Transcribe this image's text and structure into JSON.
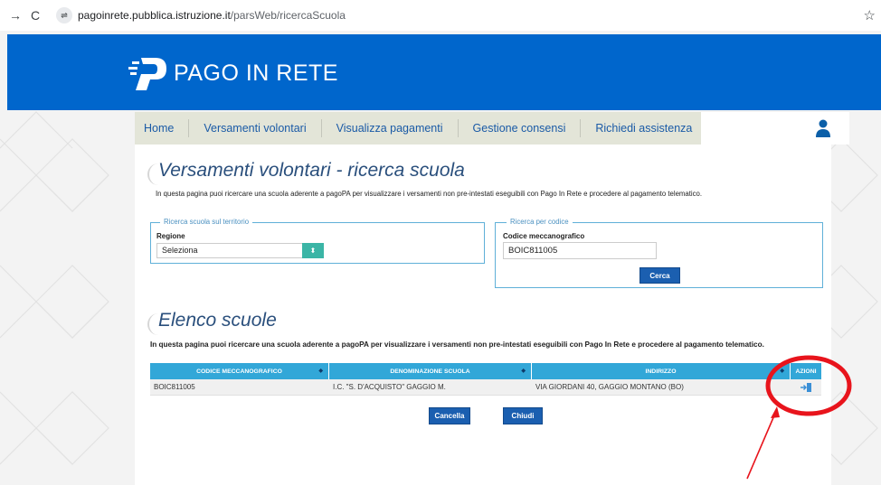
{
  "browser": {
    "url_host": "pagoinrete.pubblica.istruzione.it",
    "url_path": "/parsWeb/ricercaScuola"
  },
  "header": {
    "logo_text": "PAGO IN RETE"
  },
  "nav": {
    "items": [
      {
        "label": "Home"
      },
      {
        "label": "Versamenti volontari"
      },
      {
        "label": "Visualizza pagamenti"
      },
      {
        "label": "Gestione consensi"
      },
      {
        "label": "Richiedi assistenza"
      }
    ]
  },
  "search": {
    "title": "Versamenti volontari - ricerca scuola",
    "description": "In questa pagina puoi ricercare una scuola aderente a pagoPA per visualizzare i versamenti non pre-intestati eseguibili con Pago In Rete e procedere al pagamento telematico.",
    "territory": {
      "legend": "Ricerca scuola sul territorio",
      "region_label": "Regione",
      "region_value": "Seleziona"
    },
    "code": {
      "legend": "Ricerca per codice",
      "code_label": "Codice meccanografico",
      "code_value": "BOIC811005",
      "search_button": "Cerca"
    }
  },
  "results": {
    "title": "Elenco scuole",
    "description": "In questa pagina puoi ricercare una scuola aderente a pagoPA per visualizzare i versamenti non pre-intestati eseguibili con Pago In Rete e procedere al pagamento telematico.",
    "columns": [
      "CODICE MECCANOGRAFICO",
      "DENOMINAZIONE SCUOLA",
      "INDIRIZZO",
      "AZIONI"
    ],
    "rows": [
      {
        "code": "BOIC811005",
        "name": "I.C. \"S. D'ACQUISTO\" GAGGIO M.",
        "address": "VIA GIORDANI 40, GAGGIO MONTANO (BO)"
      }
    ],
    "cancel_button": "Cancella",
    "close_button": "Chiudi"
  },
  "colors": {
    "header_blue": "#0066cc",
    "table_header": "#32a7d8",
    "annotation_red": "#e8141c"
  }
}
